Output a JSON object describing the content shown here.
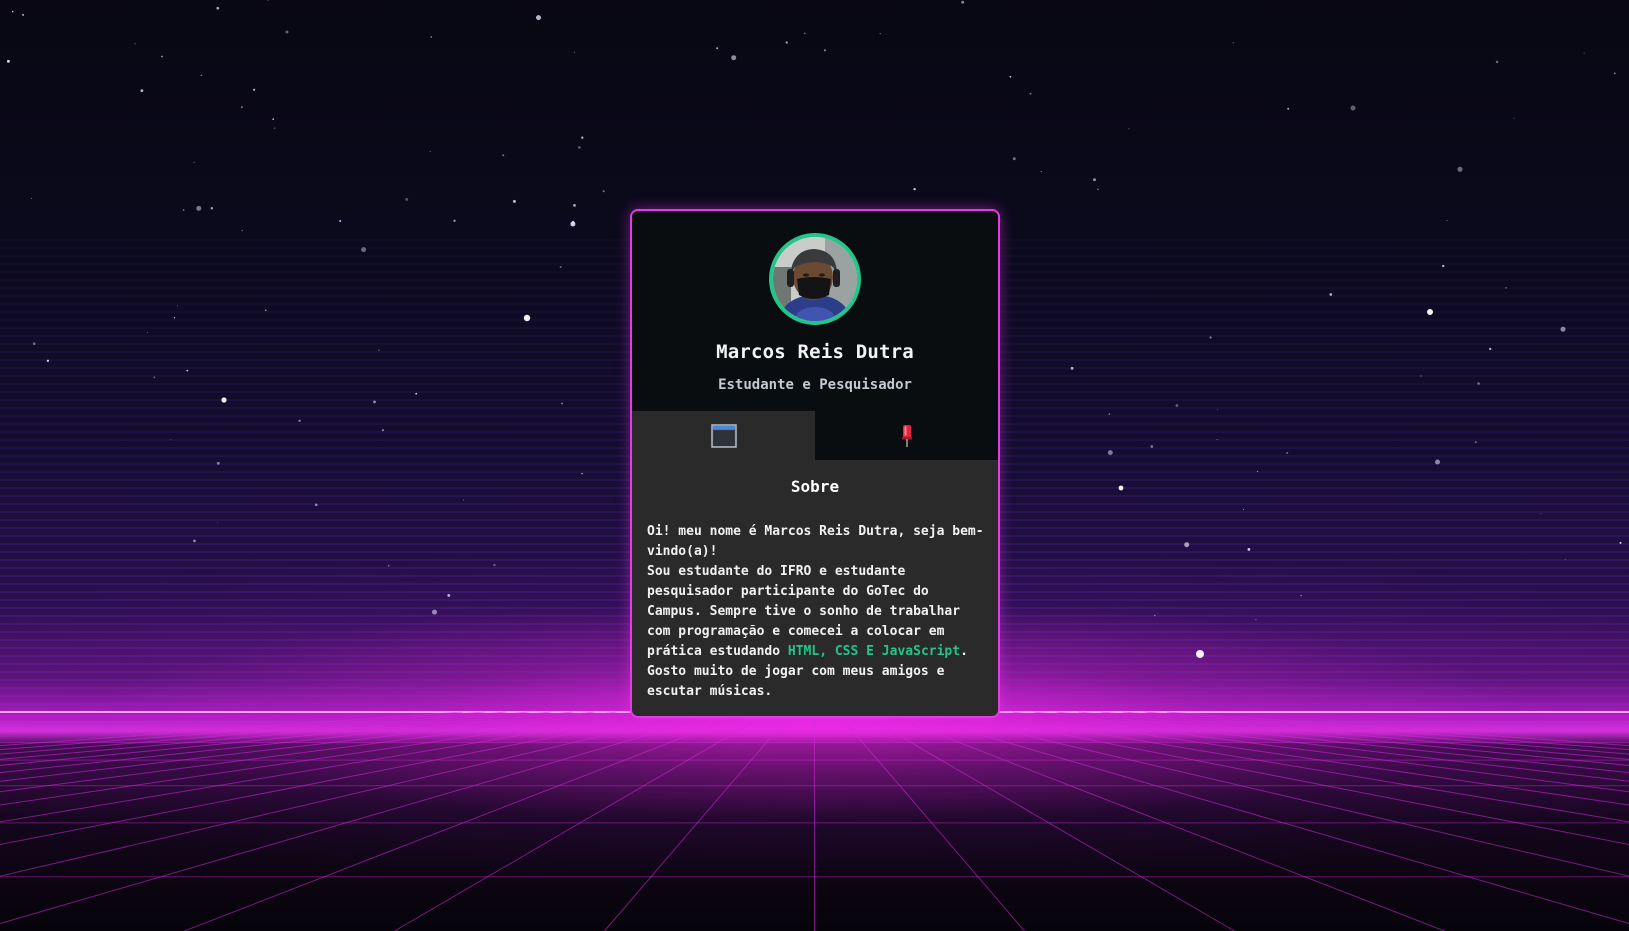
{
  "profile": {
    "name": "Marcos Reis Dutra",
    "role": "Estudante e Pesquisador"
  },
  "tabs": [
    {
      "label": "Sobre",
      "icon": "window-icon",
      "active": true
    },
    {
      "label": "",
      "icon": "pin-icon",
      "active": false
    }
  ],
  "about": {
    "title": "Sobre",
    "line1": "Oi! meu nome é Marcos Reis Dutra, seja bem-vindo(a)!",
    "text_before": "Sou estudante do IFRO e estudante pesquisador participante do GoTec do Campus. Sempre tive o sonho de trabalhar com programação e comecei a colocar em prática estudando ",
    "highlight": "HTML, CSS E JavaScript",
    "text_after": ". Gosto muito de jogar com meus amigos e escutar músicas."
  },
  "colors": {
    "card_border": "#e43be6",
    "avatar_ring": "#22c58a",
    "highlight": "#22c58a",
    "header_bg": "#0a0d10",
    "body_bg": "#2a2a2a",
    "pin_icon": "#e0263f"
  }
}
